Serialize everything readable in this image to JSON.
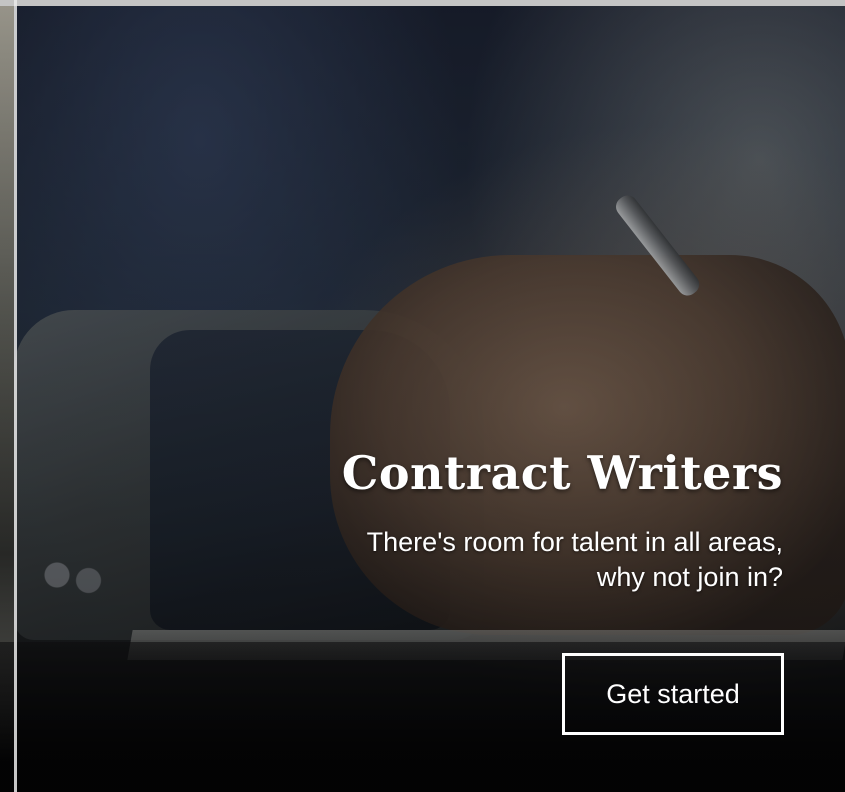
{
  "hero": {
    "title": "Contract Writers",
    "subtitle_line1": "There's room for talent in all areas,",
    "subtitle_line2": "why not join in?",
    "cta_label": "Get started"
  },
  "colors": {
    "text": "#ffffff",
    "button_border": "#ffffff",
    "overlay": "#000000"
  }
}
